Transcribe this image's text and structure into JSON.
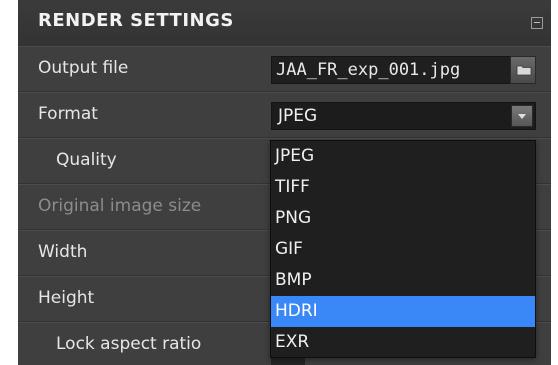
{
  "panel": {
    "title": "RENDER SETTINGS",
    "collapse_icon": "collapse-icon"
  },
  "rows": {
    "output_file": {
      "label": "Output file",
      "value": "JAA_FR_exp_001.jpg",
      "browse_icon": "folder-icon"
    },
    "format": {
      "label": "Format",
      "selected": "JPEG"
    },
    "quality": {
      "label": "Quality"
    },
    "original_size": {
      "label": "Original image size"
    },
    "width": {
      "label": "Width"
    },
    "height": {
      "label": "Height"
    },
    "lock_aspect": {
      "label": "Lock aspect ratio"
    }
  },
  "format_options": [
    "JPEG",
    "TIFF",
    "PNG",
    "GIF",
    "BMP",
    "HDRI",
    "EXR"
  ],
  "highlighted_option": "HDRI",
  "colors": {
    "panel_bg": "#3f3f3f",
    "highlight": "#3a87f7",
    "disabled_text": "#8c8c8c"
  }
}
